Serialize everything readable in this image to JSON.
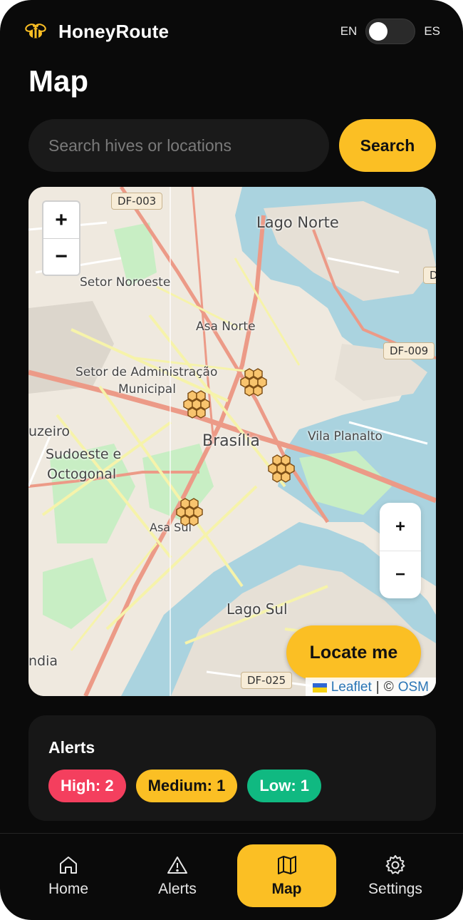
{
  "app": {
    "name": "HoneyRoute",
    "icon": "bee-icon"
  },
  "language": {
    "left": "EN",
    "right": "ES",
    "active": "EN"
  },
  "page": {
    "title": "Map"
  },
  "search": {
    "placeholder": "Search hives or locations",
    "value": "",
    "button_label": "Search"
  },
  "map": {
    "labels": {
      "lago_norte": "Lago Norte",
      "setor_noroeste": "Setor Noroeste",
      "asa_norte": "Asa Norte",
      "setor_admin_1": "Setor de Administração",
      "setor_admin_2": "Municipal",
      "cruzeiro": "uzeiro",
      "sudoeste_1": "Sudoeste e",
      "sudoeste_2": "Octogonal",
      "brasilia": "Brasília",
      "vila_planalto": "Vila Planalto",
      "asa_sul": "Asa Sul",
      "lago_sul": "Lago Sul",
      "candangolandia": "ndia"
    },
    "shields": {
      "df003": "DF-003",
      "df009": "DF-009",
      "df025": "DF-025",
      "d_right": "D"
    },
    "zoom_in": "+",
    "zoom_out": "−",
    "zoom_in_secondary": "+",
    "zoom_out_secondary": "−",
    "locate_label": "Locate me",
    "attribution": {
      "leaflet": "Leaflet",
      "separator": "|",
      "copyright": "©",
      "osm": "OSM"
    },
    "hive_markers": 4,
    "colors": {
      "water": "#aad3df",
      "park": "#c8eec4",
      "land": "#f1ece2",
      "major_road": "#ec9a87",
      "minor_road": "#f6f3aa",
      "hive": "#f8c46e"
    }
  },
  "alerts": {
    "title": "Alerts",
    "high": "High: 2",
    "medium": "Medium: 1",
    "low": "Low: 1",
    "colors": {
      "high": "#f43f5e",
      "medium": "#fbbf24",
      "low": "#10b981"
    }
  },
  "nav": {
    "items": [
      {
        "label": "Home",
        "icon": "home-icon"
      },
      {
        "label": "Alerts",
        "icon": "warning-icon"
      },
      {
        "label": "Map",
        "icon": "map-icon",
        "active": true
      },
      {
        "label": "Settings",
        "icon": "gear-icon"
      }
    ]
  },
  "accent": "#fbbf24"
}
